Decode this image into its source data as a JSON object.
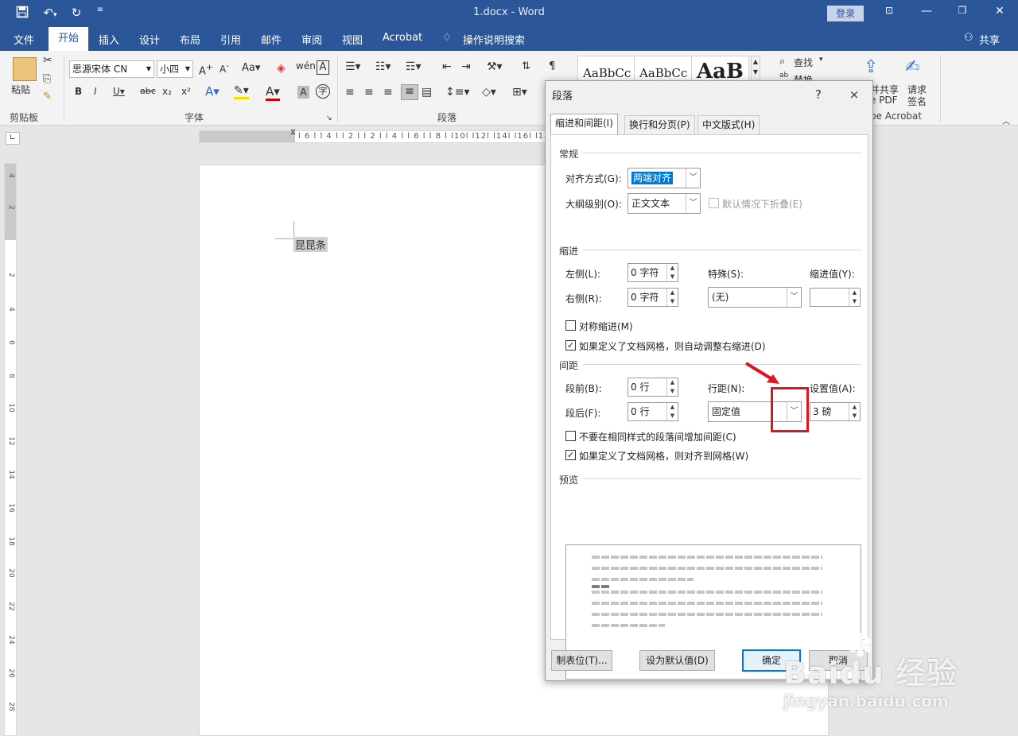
{
  "app": {
    "title": "1.docx  -  Word",
    "login_label": "登录"
  },
  "titlebar_icons": [
    "save-icon",
    "undo-icon",
    "redo-icon",
    "customize-icon"
  ],
  "menu": {
    "items": [
      "文件",
      "开始",
      "插入",
      "设计",
      "布局",
      "引用",
      "邮件",
      "审阅",
      "视图",
      "Acrobat"
    ],
    "active": "开始",
    "tell_me": "操作说明搜索",
    "share": "共享"
  },
  "ribbon": {
    "paste_label": "粘贴",
    "clipboard_label": "剪贴板",
    "font_name": "思源宋体 CN",
    "font_size": "小四",
    "font_group_label": "字体",
    "paragraph_group_label": "段落",
    "find_label": "查找",
    "replace_label": "替换",
    "styles": [
      "AaBbCc",
      "AaBbCc",
      "AaB"
    ],
    "acrobat_a": "并共享\nbe PDF",
    "acrobat_a_line1": "并共享",
    "acrobat_a_line2": "e PDF",
    "acrobat_b_line1": "请求",
    "acrobat_b_line2": "签名",
    "acrobat_group_label": "be Acrobat"
  },
  "ruler": {
    "h_ticks": "l 6 l   l 4 l   l 2 l       l 2 l   l 4 l   l 6 l   l 8 l   l10l   l12l   l14l   l16l   l18l",
    "v_ticks": [
      "4",
      "2",
      "2",
      "4",
      "6",
      "8",
      "10",
      "12",
      "14",
      "16",
      "18",
      "20",
      "22",
      "24",
      "26",
      "28",
      "30"
    ]
  },
  "document": {
    "text": "昆昆条"
  },
  "dialog": {
    "title": "段落",
    "help": "?",
    "close": "×",
    "tabs": [
      "缩进和间距(I)",
      "换行和分页(P)",
      "中文版式(H)"
    ],
    "general": {
      "section": "常规",
      "alignment_label": "对齐方式(G):",
      "alignment_value": "两端对齐",
      "outline_label": "大纲级别(O):",
      "outline_value": "正文文本",
      "collapse_label": "默认情况下折叠(E)"
    },
    "indent": {
      "section": "缩进",
      "left_label": "左侧(L):",
      "left_value": "0 字符",
      "right_label": "右侧(R):",
      "right_value": "0 字符",
      "special_label": "特殊(S):",
      "special_value": "(无)",
      "by_label": "缩进值(Y):",
      "by_value": "",
      "mirror_label": "对称缩进(M)",
      "mirror_checked": false,
      "auto_adjust_label": "如果定义了文档网格，则自动调整右缩进(D)",
      "auto_adjust_checked": true
    },
    "spacing": {
      "section": "间距",
      "before_label": "段前(B):",
      "before_value": "0 行",
      "after_label": "段后(F):",
      "after_value": "0 行",
      "line_label": "行距(N):",
      "line_value": "固定值",
      "at_label": "设置值(A):",
      "at_value": "3 磅",
      "no_space_label": "不要在相同样式的段落间增加间距(C)",
      "no_space_checked": false,
      "snap_label": "如果定义了文档网格，则对齐到网格(W)",
      "snap_checked": true
    },
    "preview": {
      "section": "预览"
    },
    "buttons": {
      "tabs": "制表位(T)...",
      "default": "设为默认值(D)",
      "ok": "确定",
      "cancel": "取消"
    }
  },
  "watermark": {
    "brand": "Baidu 经验",
    "url": "jingyan.baidu.com"
  },
  "colors": {
    "titlebar": "#2b579a",
    "highlight": "#e0151b",
    "primary_button": "#0078d7"
  }
}
